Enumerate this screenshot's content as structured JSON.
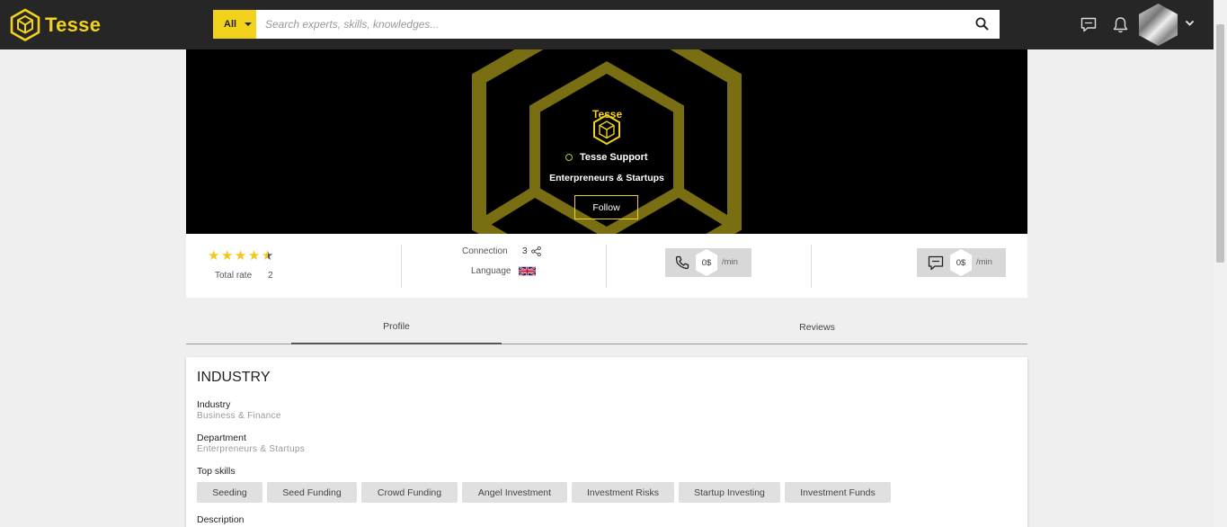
{
  "header": {
    "logo_text": "Tesse",
    "search": {
      "category": "All",
      "placeholder": "Search experts, skills, knowledges..."
    },
    "icons": [
      "chat-icon",
      "bell-icon",
      "chevron-down-icon"
    ]
  },
  "banner": {
    "logo_text": "Tesse",
    "name": "Tesse Support",
    "department": "Enterpreneurs & Startups",
    "follow_label": "Follow"
  },
  "stats": {
    "rating": 4.5,
    "total_rate_label": "Total rate",
    "total_rate_value": "2",
    "connection_label": "Connection",
    "connection_value": "3",
    "language_label": "Language",
    "call_price": "0$",
    "chat_price": "0$",
    "per_min": "/min"
  },
  "tabs": [
    {
      "label": "Profile",
      "active": true
    },
    {
      "label": "Reviews",
      "active": false
    }
  ],
  "industry": {
    "title": "INDUSTRY",
    "industry_label": "Industry",
    "industry_value": "Business & Finance",
    "department_label": "Department",
    "department_value": "Enterpreneurs & Startups",
    "top_skills_label": "Top skills",
    "skills": [
      "Seeding",
      "Seed Funding",
      "Crowd Funding",
      "Angel Investment",
      "Investment Risks",
      "Startup Investing",
      "Investment Funds"
    ],
    "description_label": "Description"
  },
  "colors": {
    "brand_yellow": "#f2d21b",
    "topbar": "#262626",
    "online_green": "#a7d930"
  }
}
